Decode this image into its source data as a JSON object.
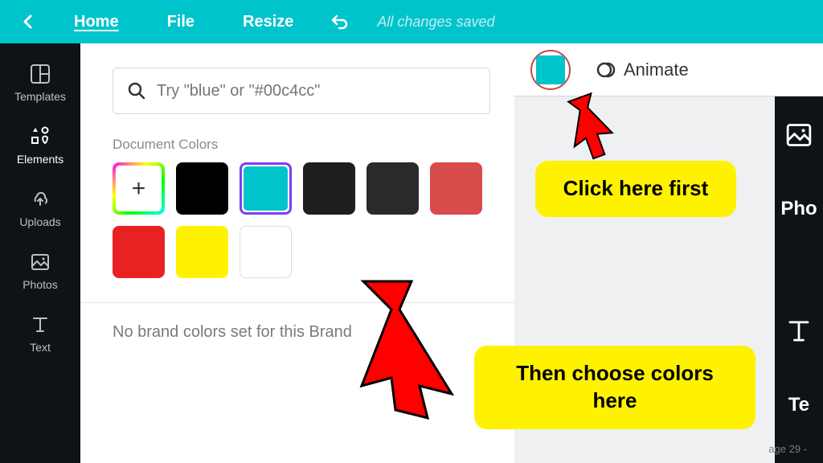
{
  "topbar": {
    "home": "Home",
    "file": "File",
    "resize": "Resize",
    "status": "All changes saved"
  },
  "sidebar": {
    "items": [
      {
        "label": "Templates"
      },
      {
        "label": "Elements"
      },
      {
        "label": "Uploads"
      },
      {
        "label": "Photos"
      },
      {
        "label": "Text"
      }
    ]
  },
  "colorPanel": {
    "searchPlaceholder": "Try \"blue\" or \"#00c4cc\"",
    "documentColorsTitle": "Document Colors",
    "brandText": "No brand colors set for this Brand",
    "swatches": [
      {
        "color": "#000000"
      },
      {
        "color": "#00c4cc",
        "selected": true
      },
      {
        "color": "#1e1e1e"
      },
      {
        "color": "#2a2a2a"
      },
      {
        "color": "#d84b4b"
      },
      {
        "color": "#e82222"
      },
      {
        "color": "#fff200"
      },
      {
        "color": "#ffffff",
        "border": true
      }
    ]
  },
  "toolbar": {
    "currentColor": "#00c4cc",
    "animate": "Animate"
  },
  "canvas": {
    "label1": "Pho",
    "label2": "Te",
    "pageIndicator": "age 29 -"
  },
  "callouts": {
    "first": "Click here first",
    "second": "Then choose colors here"
  }
}
